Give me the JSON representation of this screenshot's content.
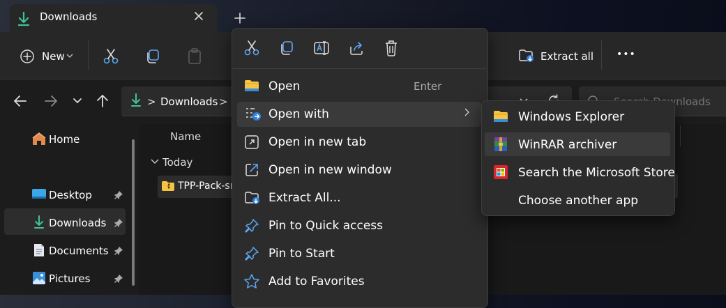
{
  "window": {
    "tab_title": "Downloads",
    "new_tab_symbol": "+"
  },
  "toolbar": {
    "new_label": "New",
    "extract_all_label": "Extract all",
    "more_symbol": "•••"
  },
  "address": {
    "location": "Downloads",
    "chevron": ">",
    "search_placeholder": "Search Downloads"
  },
  "nav_pane": {
    "items": [
      {
        "label": "Home",
        "icon": "home-icon"
      },
      {
        "label": "Desktop",
        "icon": "desktop-icon",
        "pinned": true
      },
      {
        "label": "Downloads",
        "icon": "download-icon",
        "pinned": true,
        "selected": true
      },
      {
        "label": "Documents",
        "icon": "documents-icon",
        "pinned": true
      },
      {
        "label": "Pictures",
        "icon": "pictures-icon",
        "pinned": true
      }
    ]
  },
  "file_list": {
    "column_name": "Name",
    "group_label": "Today",
    "file_name": "TPP-Pack-sr"
  },
  "context_menu": {
    "quick_actions": [
      "cut-icon",
      "copy-icon",
      "rename-icon",
      "share-icon",
      "delete-icon"
    ],
    "items": [
      {
        "label": "Open",
        "accelerator": "Enter",
        "icon": "folder-icon"
      },
      {
        "label": "Open with",
        "icon": "open-with-icon",
        "has_submenu": true
      },
      {
        "label": "Open in new tab",
        "icon": "new-tab-icon"
      },
      {
        "label": "Open in new window",
        "icon": "new-window-icon"
      },
      {
        "label": "Extract All...",
        "icon": "extract-icon"
      },
      {
        "label": "Pin to Quick access",
        "icon": "pin-icon"
      },
      {
        "label": "Pin to Start",
        "icon": "pin-icon"
      },
      {
        "label": "Add to Favorites",
        "icon": "star-icon"
      }
    ]
  },
  "submenu": {
    "items": [
      {
        "label": "Windows Explorer",
        "icon": "folder-icon"
      },
      {
        "label": "WinRAR archiver",
        "icon": "winrar-icon"
      },
      {
        "label": "Search the Microsoft Store",
        "icon": "store-icon"
      },
      {
        "label": "Choose another app",
        "icon": ""
      }
    ]
  },
  "colors": {
    "accent_green": "#3fc398",
    "folder_yellow": "#f6c343",
    "pin_blue": "#5ea6f2"
  }
}
